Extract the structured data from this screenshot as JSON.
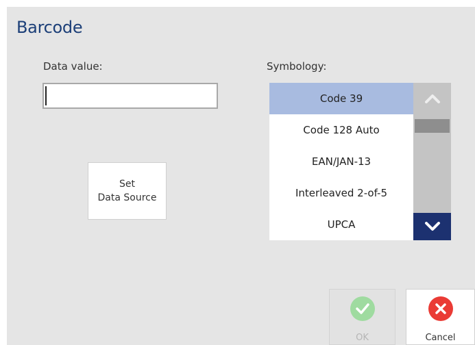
{
  "title": "Barcode",
  "data_value": {
    "label": "Data value:",
    "value": ""
  },
  "set_data_source": {
    "line1": "Set",
    "line2": "Data Source"
  },
  "symbology": {
    "label": "Symbology:",
    "items": [
      "Code 39",
      "Code 128 Auto",
      "EAN/JAN-13",
      "Interleaved 2-of-5",
      "UPCA"
    ],
    "selected": "Code 39"
  },
  "actions": {
    "ok_label": "OK",
    "cancel_label": "Cancel",
    "ok_enabled": false
  },
  "colors": {
    "title": "#1c3f78",
    "selected_item": "#a8bbe0",
    "scroll_down": "#1c3170",
    "ok_icon": "#9fdba0",
    "cancel_icon": "#ea3b35"
  },
  "icons": {
    "scroll_up": "chevron-up-icon",
    "scroll_down": "chevron-down-icon",
    "ok": "checkmark-icon",
    "cancel": "close-icon"
  }
}
